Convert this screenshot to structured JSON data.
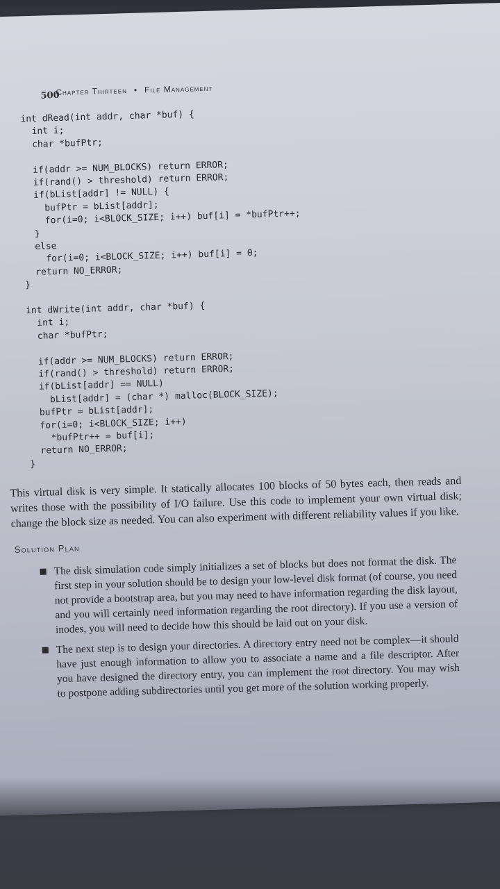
{
  "page": {
    "number": "500",
    "running_head_chapter": "Chapter Thirteen",
    "running_head_bullet": "•",
    "running_head_title": "File Management"
  },
  "code": {
    "dread": "int dRead(int addr, char *buf) {\n  int i;\n  char *bufPtr;\n\n  if(addr >= NUM_BLOCKS) return ERROR;\n  if(rand() > threshold) return ERROR;\n  if(bList[addr] != NULL) {\n    bufPtr = bList[addr];\n    for(i=0; i<BLOCK_SIZE; i++) buf[i] = *bufPtr++;\n  }\n  else\n    for(i=0; i<BLOCK_SIZE; i++) buf[i] = 0;\n  return NO_ERROR;\n}",
    "dwrite": "int dWrite(int addr, char *buf) {\n  int i;\n  char *bufPtr;\n\n  if(addr >= NUM_BLOCKS) return ERROR;\n  if(rand() > threshold) return ERROR;\n  if(bList[addr] == NULL)\n    bList[addr] = (char *) malloc(BLOCK_SIZE);\n  bufPtr = bList[addr];\n  for(i=0; i<BLOCK_SIZE; i++)\n    *bufPtr++ = buf[i];\n  return NO_ERROR;\n}"
  },
  "intro_paragraph": "This virtual disk is very simple. It statically allocates 100 blocks of 50 bytes each, then reads and writes those with the possibility of I/O failure. Use this code to implement your own virtual disk; change the block size as needed. You can also experiment with different reliability values if you like.",
  "section": {
    "heading": "Solution Plan",
    "bullets": [
      "The disk simulation code simply initializes a set of blocks but does not format the disk. The first step in your solution should be to design your low-level disk format (of course, you need not provide a bootstrap area, but you may need to have information regarding the disk layout, and you will certainly need information regarding the root directory). If you use a version of inodes, you will need to decide how this should be laid out on your disk.",
      "The next step is to design your directories. A directory entry need not be complex—it should have just enough information to allow you to associate a name and a file descriptor. After you have designed the directory entry, you can implement the root directory. You may wish to postpone adding subdirectories until you get more of the solution working properly."
    ]
  },
  "colors": {
    "paper": "#cfd2db",
    "ink": "#26262c",
    "background": "#3a3c44"
  }
}
